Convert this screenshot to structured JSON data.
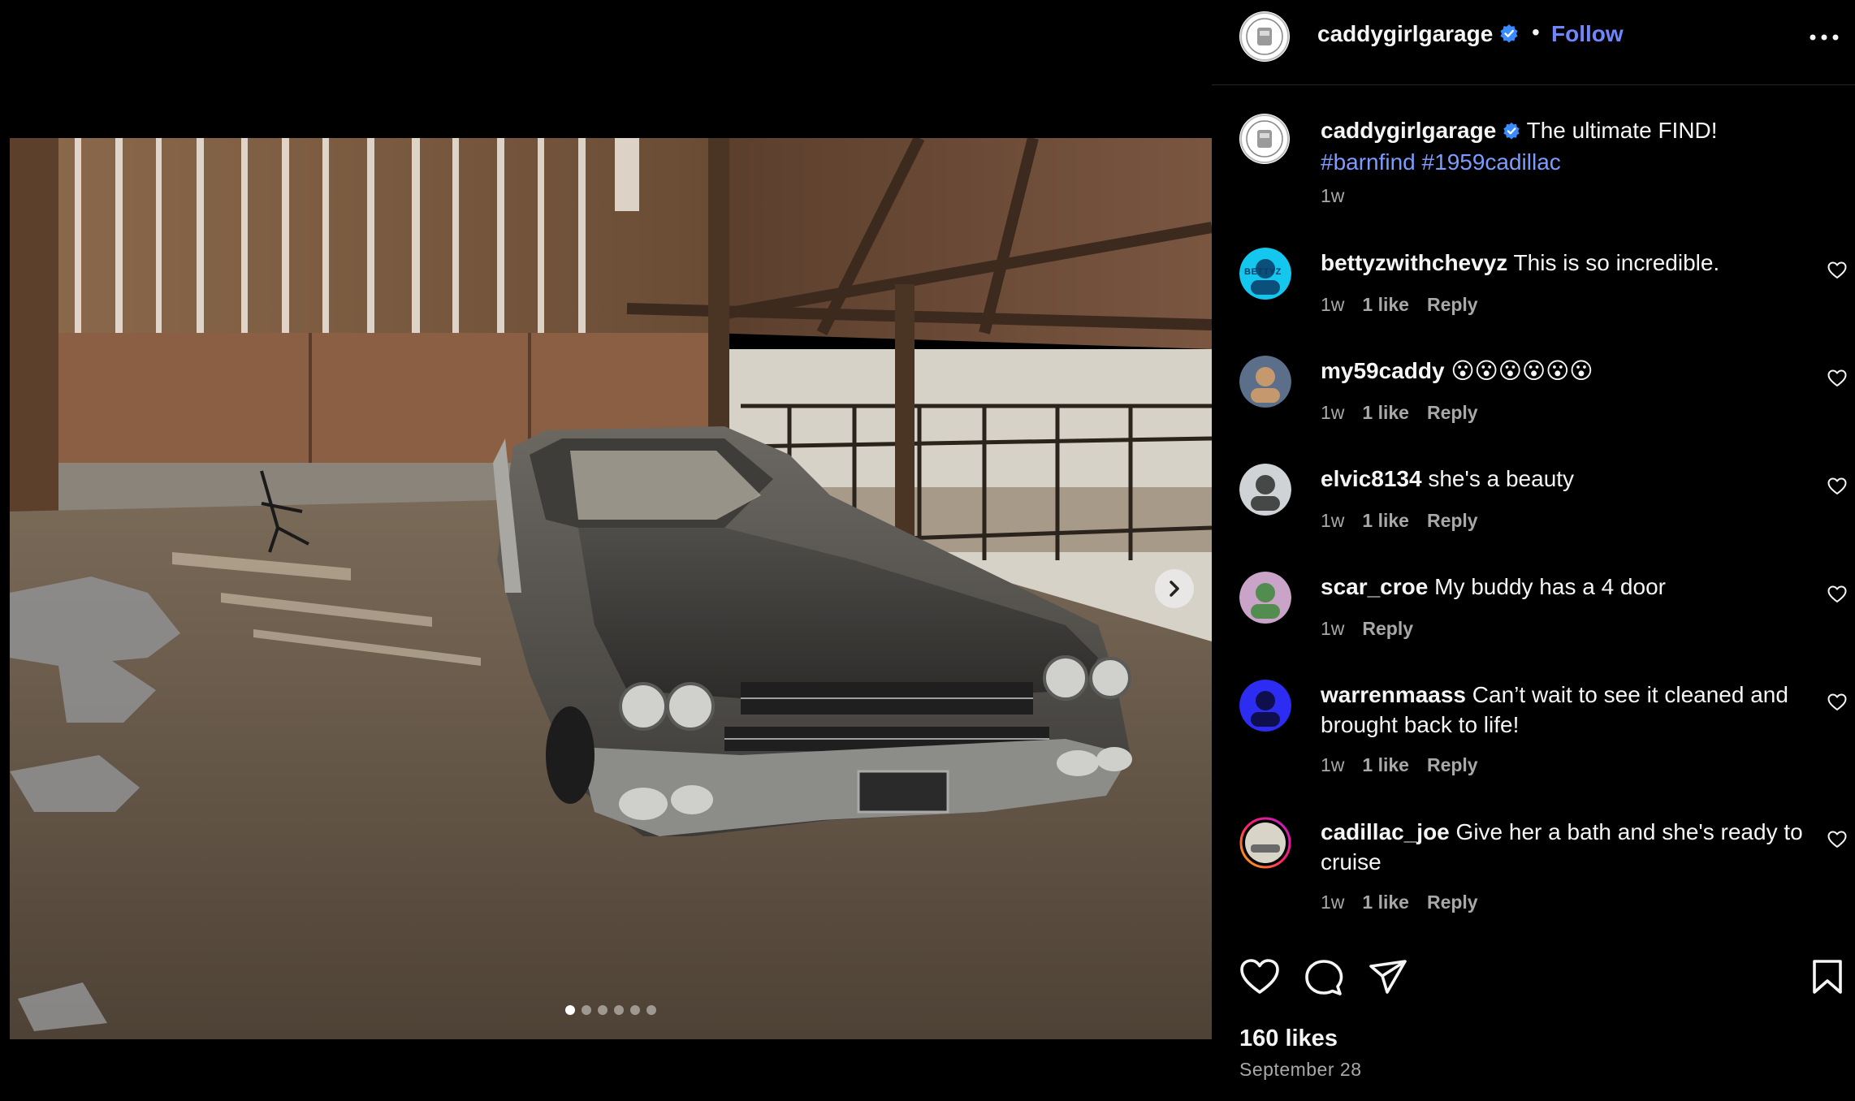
{
  "post": {
    "username": "caddygirlgarage",
    "follow_label": "Follow",
    "separator": "•",
    "caption_text": "The ultimate FIND!",
    "hashtags": [
      "#barnfind",
      "#1959cadillac"
    ],
    "caption_time": "1w",
    "likes_text": "160 likes",
    "date_text": "September 28",
    "carousel": {
      "slide_count": 6,
      "active_index": 0
    }
  },
  "comments": [
    {
      "user": "bettyzwithchevyz",
      "text": "This is so incredible.",
      "time": "1w",
      "likes": "1 like",
      "reply": "Reply",
      "avatar_label": "BETTYZ"
    },
    {
      "user": "my59caddy",
      "text": "😮😮😮😮😮😮",
      "time": "1w",
      "likes": "1 like",
      "reply": "Reply"
    },
    {
      "user": "elvic8134",
      "text": "she's a beauty",
      "time": "1w",
      "likes": "1 like",
      "reply": "Reply"
    },
    {
      "user": "scar_croe",
      "text": "My buddy has a 4 door",
      "time": "1w",
      "likes": "",
      "reply": "Reply"
    },
    {
      "user": "warrenmaass",
      "text": "Can’t wait to see it cleaned and brought back to life!",
      "time": "1w",
      "likes": "1 like",
      "reply": "Reply"
    },
    {
      "user": "cadillac_joe",
      "text": "Give her a bath and she's ready to cruise",
      "time": "1w",
      "likes": "1 like",
      "reply": "Reply"
    }
  ],
  "icons": {
    "more": "more-horizontal-icon",
    "verified": "verified-badge-icon",
    "like": "heart-icon",
    "comment": "comment-icon",
    "share": "paper-plane-icon",
    "save": "bookmark-icon",
    "next": "chevron-right-icon"
  },
  "colors": {
    "accent": "#6f86ff",
    "hashtag": "#7d9bff",
    "verified": "#3a8bff",
    "muted": "#a8a8a8",
    "background": "#000000"
  }
}
